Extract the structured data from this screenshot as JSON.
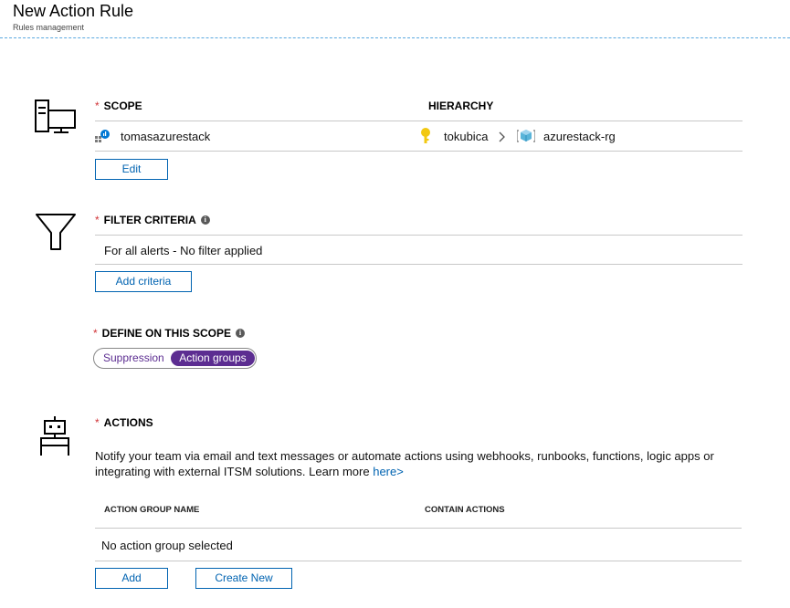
{
  "header": {
    "title": "New Action Rule",
    "subtitle": "Rules management"
  },
  "scope": {
    "title": "SCOPE",
    "hierarchy_label": "HIERARCHY",
    "resource_name": "tomasazurestack",
    "hierarchy": [
      "tokubica",
      "azurestack-rg"
    ],
    "edit_label": "Edit"
  },
  "filter": {
    "title": "FILTER CRITERIA",
    "value": "For all alerts - No filter applied",
    "add_label": "Add criteria"
  },
  "define": {
    "title": "DEFINE ON THIS SCOPE",
    "options": [
      "Suppression",
      "Action groups"
    ],
    "selected": "Action groups"
  },
  "actions": {
    "title": "ACTIONS",
    "description": "Notify your team via email and text messages or automate actions using webhooks, runbooks, functions, logic apps or integrating with external ITSM solutions. Learn more",
    "link_text": "here>",
    "columns": [
      "ACTION GROUP NAME",
      "CONTAIN ACTIONS"
    ],
    "empty_text": "No action group selected",
    "add_label": "Add",
    "create_label": "Create New"
  },
  "colors": {
    "required": "#d13438",
    "link": "#0063b1",
    "toggle_active": "#5c2d91",
    "key": "#f2c811"
  },
  "icons": [
    "monitor-icon",
    "funnel-icon",
    "robot-icon",
    "resource-icon",
    "key-icon",
    "chevron-right-icon",
    "resource-group-icon",
    "info-icon"
  ]
}
